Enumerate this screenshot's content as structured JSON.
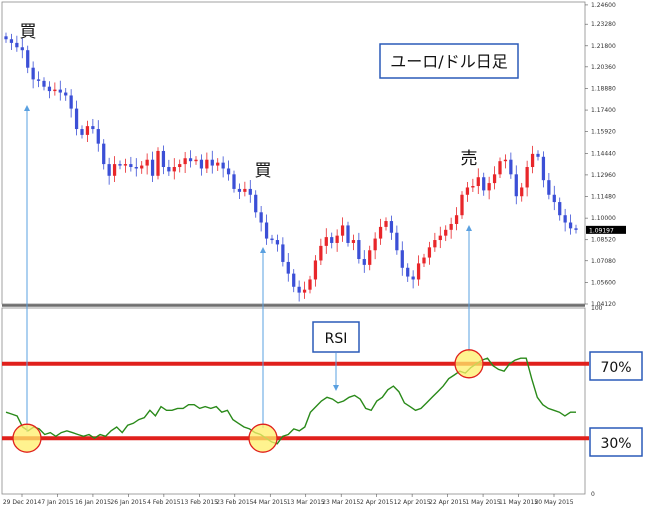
{
  "chart_title": "ユーロ/ドル日足",
  "signals": [
    {
      "label": "買",
      "kind": "buy"
    },
    {
      "label": "買",
      "kind": "buy"
    },
    {
      "label": "売",
      "kind": "sell"
    }
  ],
  "rsi_label": "RSI",
  "level_labels": [
    "70%",
    "30%"
  ],
  "colors": {
    "bull": "#e8262a",
    "bear": "#3b4fd6",
    "rsi_line": "#2a8a1a",
    "level_line": "#e0201c",
    "arrow": "#5aa0e0",
    "highlight_fill": "#ffef6a",
    "highlight_stroke": "#e0201c",
    "current_price_bg": "#000000"
  },
  "chart_data": [
    {
      "type": "candlestick",
      "title": "ユーロ/ドル日足",
      "ylim": [
        1.0412,
        1.248
      ],
      "yticks": [
        "1.24600",
        "1.23280",
        "1.21800",
        "1.20360",
        "1.18880",
        "1.17400",
        "1.15920",
        "1.14440",
        "1.12960",
        "1.11480",
        "1.10000",
        "1.08520",
        "1.07080",
        "1.05600",
        "1.04120"
      ],
      "current_price": "1.09197",
      "grid": false,
      "closes": [
        1.2225,
        1.22,
        1.217,
        1.215,
        1.203,
        1.195,
        1.194,
        1.19,
        1.187,
        1.188,
        1.186,
        1.184,
        1.175,
        1.161,
        1.157,
        1.163,
        1.161,
        1.151,
        1.137,
        1.129,
        1.137,
        1.136,
        1.137,
        1.135,
        1.134,
        1.136,
        1.14,
        1.129,
        1.146,
        1.135,
        1.132,
        1.135,
        1.137,
        1.141,
        1.139,
        1.14,
        1.134,
        1.14,
        1.136,
        1.138,
        1.134,
        1.13,
        1.12,
        1.118,
        1.12,
        1.116,
        1.104,
        1.097,
        1.086,
        1.085,
        1.082,
        1.07,
        1.062,
        1.053,
        1.049,
        1.051,
        1.058,
        1.071,
        1.081,
        1.087,
        1.083,
        1.088,
        1.095,
        1.083,
        1.085,
        1.072,
        1.068,
        1.078,
        1.086,
        1.094,
        1.098,
        1.09,
        1.078,
        1.066,
        1.06,
        1.058,
        1.069,
        1.073,
        1.08,
        1.085,
        1.088,
        1.092,
        1.096,
        1.102,
        1.116,
        1.121,
        1.122,
        1.128,
        1.119,
        1.124,
        1.13,
        1.139,
        1.14,
        1.13,
        1.115,
        1.121,
        1.135,
        1.144,
        1.142,
        1.126,
        1.116,
        1.111,
        1.102,
        1.097,
        1.093,
        1.092
      ]
    },
    {
      "type": "line",
      "title": "",
      "series": [
        {
          "values": [
            44,
            43,
            42,
            36,
            34,
            36,
            35,
            32,
            33,
            31,
            33,
            34,
            33,
            32,
            31,
            32,
            30,
            32,
            31,
            34,
            36,
            33,
            37,
            38,
            40,
            41,
            45,
            42,
            47,
            45,
            45,
            46,
            46,
            48,
            48,
            46,
            47,
            46,
            47,
            44,
            45,
            40,
            38,
            36,
            35,
            33,
            32,
            30,
            28,
            27,
            31,
            32,
            35,
            34,
            36,
            44,
            47,
            50,
            52,
            51,
            49,
            50,
            52,
            53,
            51,
            46,
            45,
            50,
            52,
            56,
            58,
            55,
            49,
            47,
            45,
            46,
            49,
            52,
            55,
            58,
            62,
            64,
            66,
            65,
            68,
            70,
            72,
            73,
            69,
            67,
            66,
            70,
            72,
            73,
            73,
            62,
            52,
            48,
            46,
            45,
            44,
            42,
            44,
            44
          ]
        }
      ],
      "ylim": [
        0,
        100
      ],
      "yticks": [
        "100",
        "70",
        "30",
        "0"
      ],
      "x_tick_labels": [
        "29 Dec 2014",
        "7 Jan 2015",
        "16 Jan 2015",
        "26 Jan 2015",
        "4 Feb 2015",
        "13 Feb 2015",
        "23 Feb 2015",
        "4 Mar 2015",
        "13 Mar 2015",
        "23 Mar 2015",
        "2 Apr 2015",
        "12 Apr 2015",
        "22 Apr 2015",
        "1 May 2015",
        "11 May 2015",
        "20 May 2015"
      ],
      "levels": [
        70,
        30
      ]
    }
  ]
}
